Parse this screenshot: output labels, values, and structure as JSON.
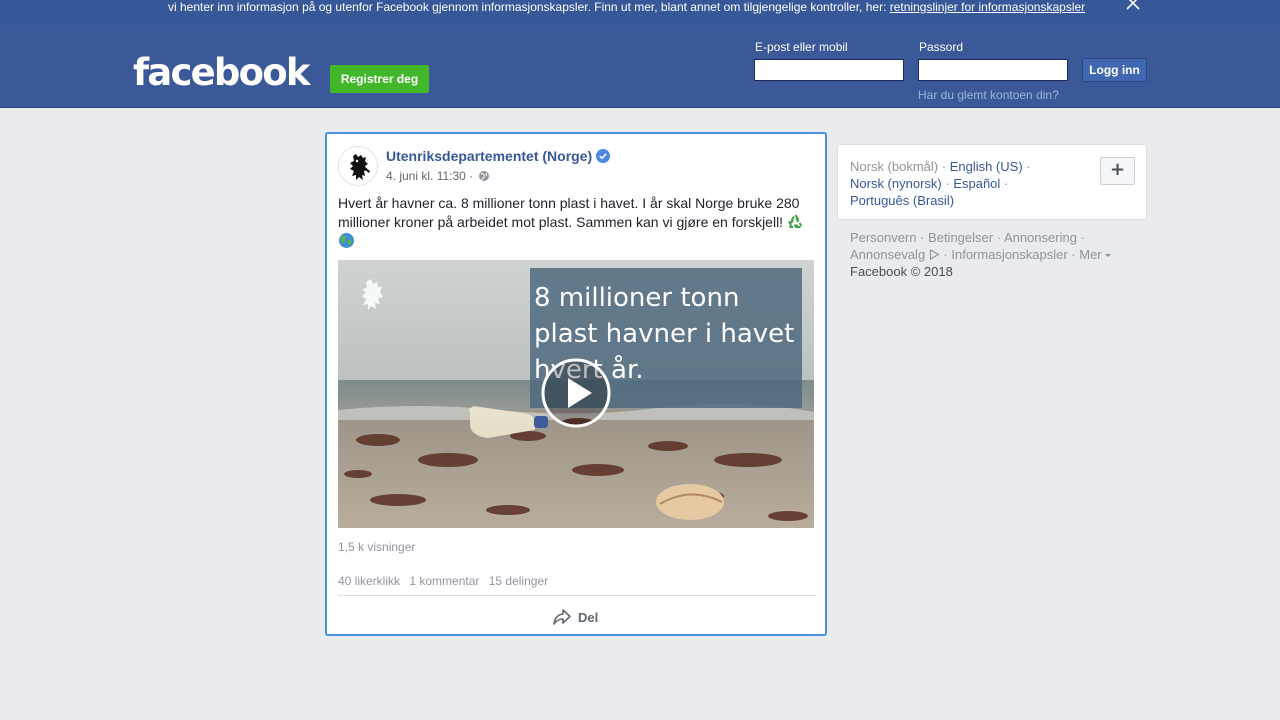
{
  "cookie_banner": {
    "text": "vi henter inn informasjon på og utenfor Facebook gjennom informasjonskapsler. Finn ut mer, blant annet om tilgjengelige kontroller, her: ",
    "link": "retningslinjer for informasjonskapsler",
    "close_icon": "close-icon"
  },
  "header": {
    "logo": "facebook",
    "register_label": "Registrer deg",
    "email_label": "E-post eller mobil",
    "email_value": "",
    "password_label": "Passord",
    "password_value": "",
    "login_label": "Logg inn",
    "forgot_label": "Har du glemt kontoen din?"
  },
  "post": {
    "page_name": "Utenriksdepartementet (Norge)",
    "verified_icon": "verified-badge-icon",
    "date": "4. juni kl. 11:30 ·",
    "audience_icon": "globe-icon",
    "text": "Hvert år havner ca. 8 millioner tonn plast i havet. I år skal Norge bruke 280 millioner kroner på arbeidet mot plast. Sammen kan vi gjøre en forskjell!",
    "emojis": [
      "recycle-icon",
      "globe-earth-icon"
    ],
    "video_overlay_text": "8 millioner tonn plast havner i havet hvert år.",
    "views": "1,5 k visninger",
    "likes": "40 likerklikk",
    "comments": "1 kommentar",
    "shares": "15 delinger",
    "share_label": "Del",
    "colors": {
      "accent": "#365899",
      "focus_border": "#4a90e2"
    }
  },
  "languages": {
    "current": "Norsk (bokmål)",
    "options": [
      "English (US)",
      "Norsk (nynorsk)",
      "Español",
      "Português (Brasil)"
    ],
    "add_label": "+"
  },
  "footer": {
    "links": [
      "Personvern",
      "Betingelser",
      "Annonsering",
      "Annonsevalg",
      "Informasjonskapsler",
      "Mer"
    ],
    "copyright": "Facebook © 2018"
  },
  "colors": {
    "header_bg": "#3b5998",
    "banner_bg": "#365899",
    "register_green": "#42b72a",
    "page_bg": "#e9ebee"
  }
}
